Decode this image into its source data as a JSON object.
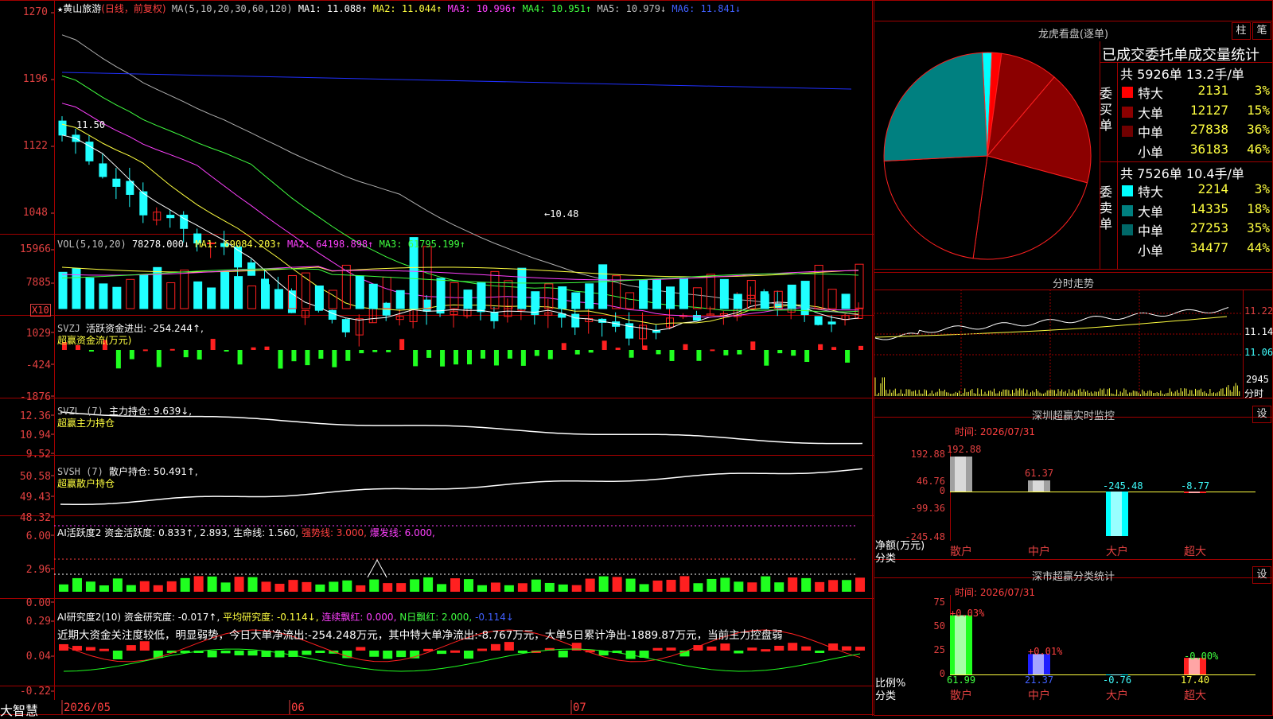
{
  "stock": {
    "name": "黄山旅游",
    "mode": "(日线，前复权)",
    "star": "★"
  },
  "ma_header": {
    "label": "MA(5,10,20,30,60,120)",
    "items": [
      {
        "t": "MA1: 11.088↑",
        "c": "#ffffff"
      },
      {
        "t": "MA2: 11.044↑",
        "c": "#ffff40"
      },
      {
        "t": "MA3: 10.996↑",
        "c": "#ff40ff"
      },
      {
        "t": "MA4: 10.951↑",
        "c": "#40ff40"
      },
      {
        "t": "MA5: 10.979↓",
        "c": "#c0c0c0"
      },
      {
        "t": "MA6: 11.841↓",
        "c": "#4060ff"
      }
    ]
  },
  "price_axis": [
    "1270",
    "1196",
    "1122",
    "1048"
  ],
  "price_marks": {
    "high": "11.50",
    "low": "←10.48"
  },
  "vol_header": {
    "label": "VOL(5,10,20)",
    "val": "78278.000↓",
    "items": [
      {
        "t": "MA1: 69084.203↑",
        "c": "#ffff40"
      },
      {
        "t": "MA2: 64198.898↑",
        "c": "#ff40ff"
      },
      {
        "t": "MA3: 61795.199↑",
        "c": "#40ff40"
      }
    ]
  },
  "vol_axis": [
    "15966",
    "7885"
  ],
  "vol_unit": "X10",
  "svzj": {
    "label": "SVZJ",
    "desc": "活跃资金进出: -254.244↑,",
    "sub": "超赢资金流(万元)",
    "axis": [
      "1029",
      "-424",
      "-1876"
    ]
  },
  "svzl": {
    "label": "SVZL (7)",
    "desc": "主力持仓: 9.639↓,",
    "sub": "超赢主力持仓",
    "axis": [
      "12.36",
      "10.94",
      "9.52"
    ]
  },
  "svsh": {
    "label": "SVSH (7)",
    "desc": "散户持仓: 50.491↑,",
    "sub": "超赢散户持仓",
    "axis": [
      "50.58",
      "49.43",
      "48.32"
    ]
  },
  "ai1": {
    "label": "AI活跃度2",
    "desc": "资金活跃度: 0.833↑, 2.893, 生命线: 1.560,",
    "strong": "强势线: 3.000,",
    "burst": "爆发线: 6.000,",
    "axis": [
      "6.00",
      "2.96",
      "0.00"
    ]
  },
  "ai2": {
    "label": "AI研究度2(10)",
    "desc": "资金研究度: -0.017↑,",
    "avg": "平均研究度: -0.114↓,",
    "cont": "连续飘红: 0.000,",
    "nday": "N日飘红: 2.000,",
    "last": "-0.114↓",
    "note": "近期大资金关注度较低，明显弱势，今日大单净流出:-254.248万元，其中特大单净流出:-8.767万元，大单5日累计净出-1889.87万元，当前主力控盘弱",
    "axis": [
      "0.29",
      "0.04",
      "-0.22"
    ]
  },
  "bottom": {
    "brand": "大智慧",
    "dates": [
      "2026/05",
      "06",
      "07"
    ]
  },
  "dragon": {
    "title": "龙虎看盘(逐单)",
    "btn1": "柱",
    "btn2": "笔",
    "subtitle": "已成交委托单成交量统计",
    "buy": {
      "side": "委买单",
      "total": "共 5926单 13.2手/单",
      "rows": [
        {
          "n": "特大",
          "v": "2131",
          "p": "3%",
          "c": "#ff0000"
        },
        {
          "n": "大单",
          "v": "12127",
          "p": "15%",
          "c": "#8b0000"
        },
        {
          "n": "中单",
          "v": "27838",
          "p": "36%",
          "c": "#700000"
        },
        {
          "n": "小单",
          "v": "36183",
          "p": "46%",
          "c": "#000000"
        }
      ]
    },
    "sell": {
      "side": "委卖单",
      "total": "共 7526单 10.4手/单",
      "rows": [
        {
          "n": "特大",
          "v": "2214",
          "p": "3%",
          "c": "#00ffff"
        },
        {
          "n": "大单",
          "v": "14335",
          "p": "18%",
          "c": "#008080"
        },
        {
          "n": "中单",
          "v": "27253",
          "p": "35%",
          "c": "#006868"
        },
        {
          "n": "小单",
          "v": "34477",
          "p": "44%",
          "c": "#000000"
        }
      ]
    }
  },
  "intraday": {
    "title": "分时走势",
    "axis": [
      "11.22",
      "11.14",
      "11.06"
    ],
    "vol": "2945",
    "unit": "分时"
  },
  "sz_monitor": {
    "title": "深圳超赢实时监控",
    "btn": "设",
    "time": "时间: 2026/07/31",
    "axis": [
      "192.88",
      "46.76",
      "0",
      "-99.36",
      "-245.48"
    ],
    "ylabel": "净额(万元)",
    "xlabel": "分类",
    "cats": [
      "散户",
      "中户",
      "大户",
      "超大"
    ],
    "values": [
      "192.88",
      "61.37",
      "-245.48",
      "-8.77"
    ]
  },
  "sz_class": {
    "title": "深市超赢分类统计",
    "btn": "设",
    "time": "时间: 2026/07/31",
    "axis": [
      "75",
      "50",
      "25",
      "0"
    ],
    "ylabel": "比例%",
    "xlabel": "分类",
    "cats": [
      "散户",
      "中户",
      "大户",
      "超大"
    ],
    "pct": [
      "+0.03%",
      "+0.01%",
      "-0.00%"
    ],
    "values": [
      "61.99",
      "21.37",
      "-0.76",
      "17.40"
    ]
  }
}
